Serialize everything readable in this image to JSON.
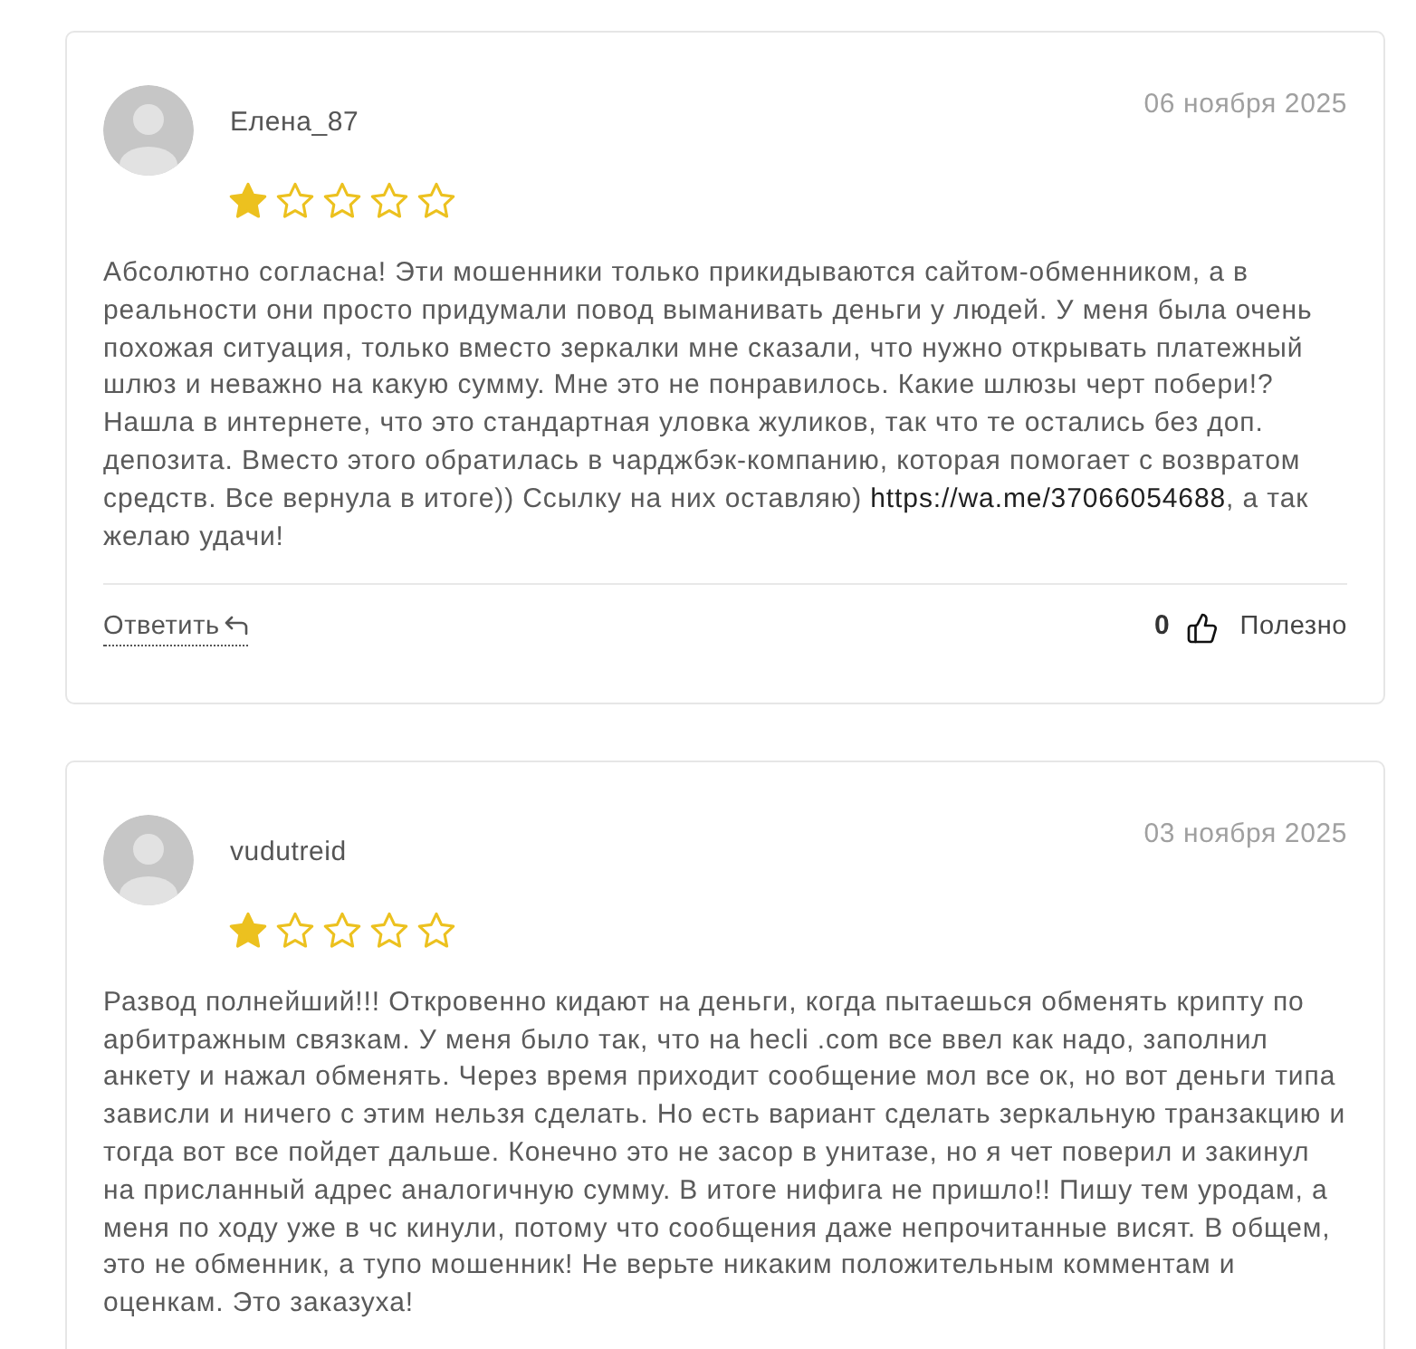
{
  "reviews": [
    {
      "author": "Елена_87",
      "date": "06 ноября 2025",
      "stars": 1,
      "body": [
        {
          "kind": "text",
          "text": "Абсолютно согласна! Эти мошенники только прикидываются сайтом-обменником, а в реальности они просто придумали повод выманивать деньги у людей. У меня была очень похожая ситуация, только вместо зеркалки мне сказали, что нужно открывать платежный шлюз и неважно на какую сумму. Мне это не понравилось. Какие шлюзы черт побери!? Нашла в интернете, что это стандартная уловка жуликов, так что те остались без доп. депозита. Вместо этого обратилась в чарджбэк-компанию, которая помогает с возвратом средств. Все вернула в итоге)) Ссылку на них оставляю) "
        },
        {
          "kind": "link",
          "text": "https://wa.me/37066054688"
        },
        {
          "kind": "text",
          "text": ", а так желаю удачи!"
        }
      ],
      "reply": "Ответить",
      "likes": "0",
      "helpful": "Полезно"
    },
    {
      "author": "vudutreid",
      "date": "03 ноября 2025",
      "stars": 1,
      "body": [
        {
          "kind": "text",
          "text": "Развод полнейший!!! Откровенно кидают на деньги, когда пытаешься обменять крипту по арбитражным связкам. У меня было так, что на hecli .com все ввел как надо, заполнил анкету и нажал обменять. Через время приходит сообщение мол все ок, но вот деньги типа зависли и ничего с этим нельзя сделать. Но есть вариант сделать зеркальную транзакцию и тогда вот все пойдет дальше. Конечно это не засор в унитазе, но я чет поверил и закинул на присланный адрес аналогичную сумму. В итоге нифига не пришло!! Пишу тем уродам, а меня по ходу уже в чс кинули, потому что сообщения даже непрочитанные висят. В общем, это не обменник, а тупо мошенник! Не верьте никаким положительным комментам и оценкам. Это заказуха!"
        }
      ]
    }
  ]
}
